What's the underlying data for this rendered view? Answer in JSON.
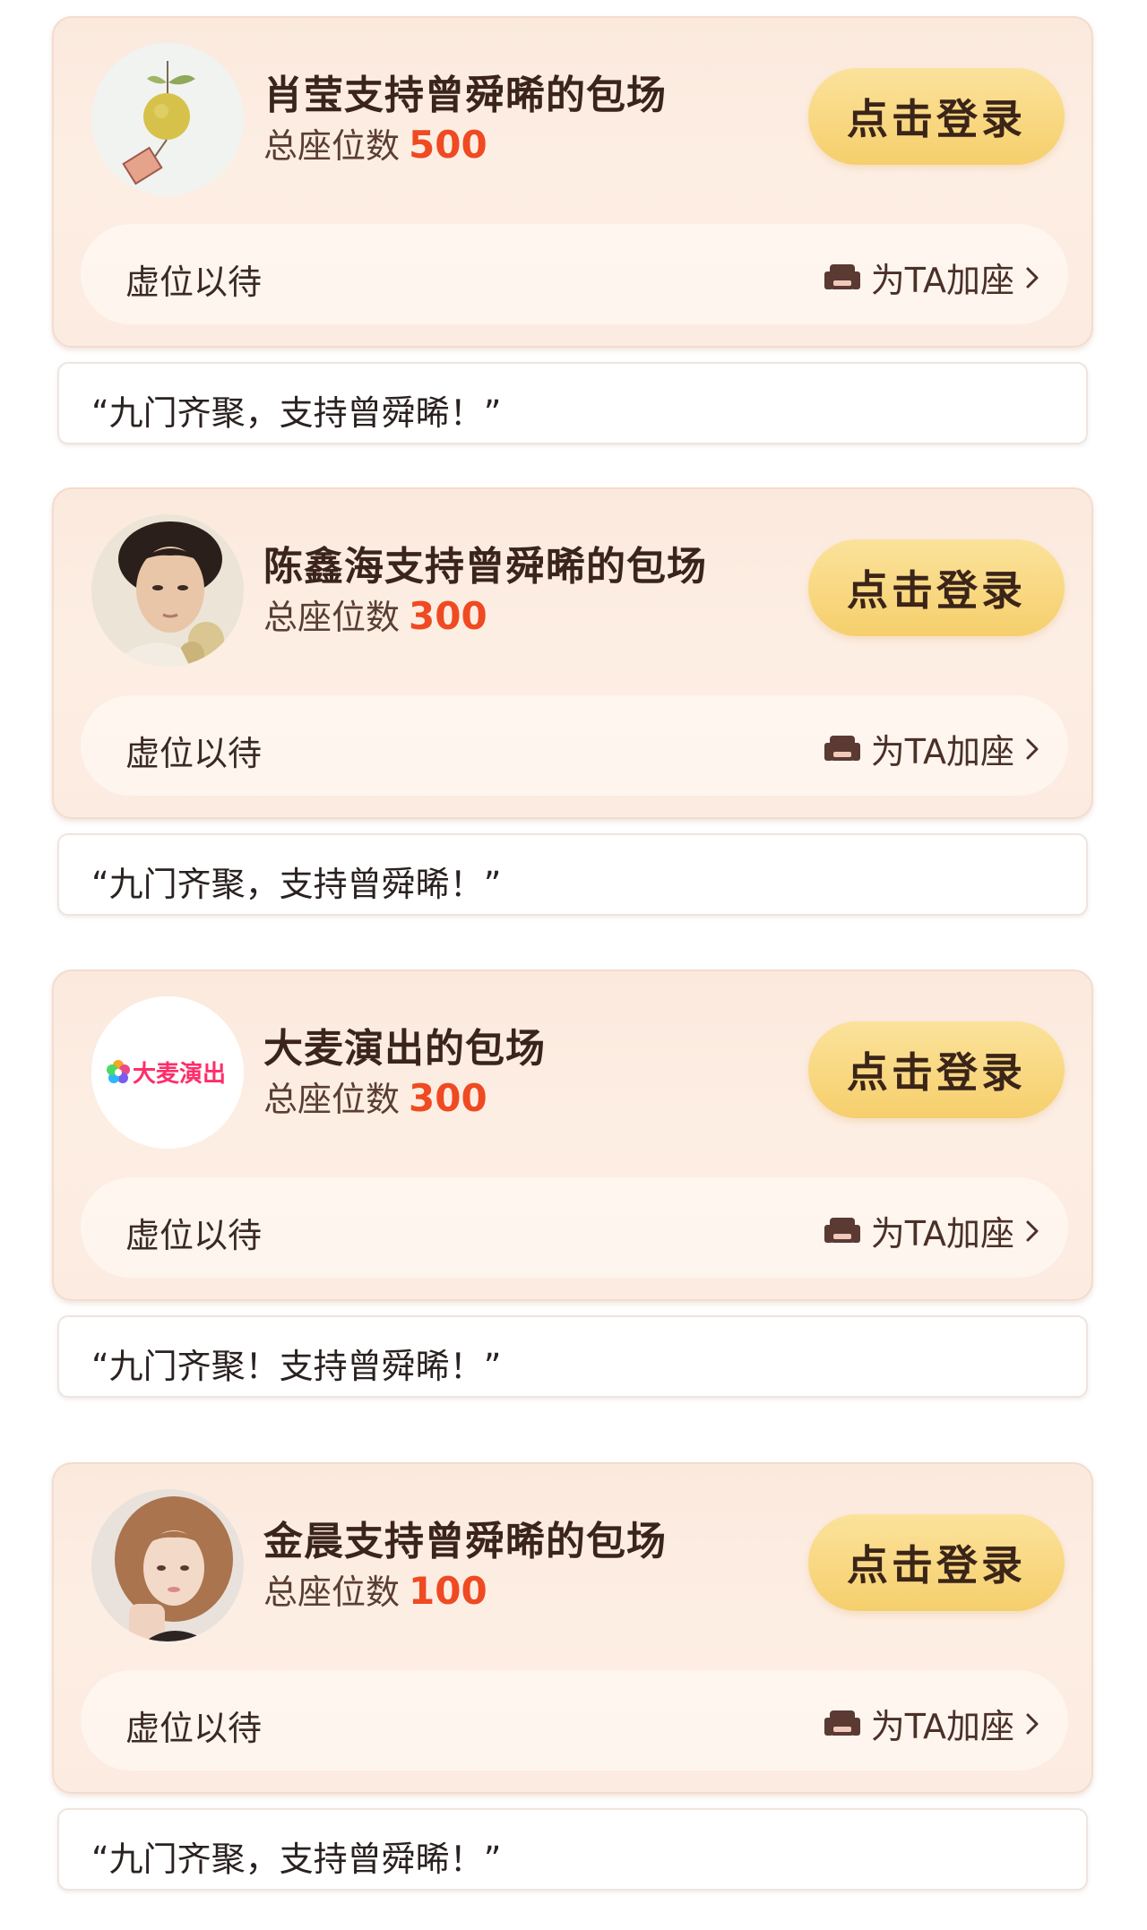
{
  "cards": [
    {
      "avatar_icon": "orange-wind-chime-icon",
      "title": "肖莹支持曾舜晞的包场",
      "seats_label": "总座位数",
      "seats_count": "500",
      "login_label": "点击登录",
      "waiting_text": "虚位以待",
      "add_seat_label": "为TA加座",
      "message": "“九门齐聚，支持曾舜晞！”"
    },
    {
      "avatar_icon": "male-portrait-avatar",
      "title": "陈鑫海支持曾舜晞的包场",
      "seats_label": "总座位数",
      "seats_count": "300",
      "login_label": "点击登录",
      "waiting_text": "虚位以待",
      "add_seat_label": "为TA加座",
      "message": "“九门齐聚，支持曾舜晞！”"
    },
    {
      "avatar_icon": "damai-logo",
      "avatar_logo_text": "大麦演出",
      "title": "大麦演出的包场",
      "seats_label": "总座位数",
      "seats_count": "300",
      "login_label": "点击登录",
      "waiting_text": "虚位以待",
      "add_seat_label": "为TA加座",
      "message": "“九门齐聚！支持曾舜晞！”"
    },
    {
      "avatar_icon": "female-portrait-avatar",
      "title": "金晨支持曾舜晞的包场",
      "seats_label": "总座位数",
      "seats_count": "100",
      "login_label": "点击登录",
      "waiting_text": "虚位以待",
      "add_seat_label": "为TA加座",
      "message": "“九门齐聚，支持曾舜晞！”"
    }
  ],
  "colors": {
    "accent_number": "#ef4a22",
    "button_gold": "#f6cf6c",
    "card_bg": "#fdeee4"
  }
}
